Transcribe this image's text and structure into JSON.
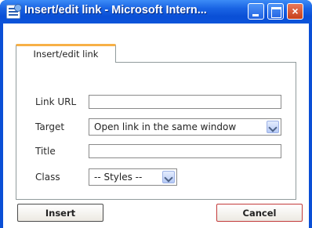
{
  "window": {
    "title": "Insert/edit link - Microsoft Intern...",
    "close_glyph": "×"
  },
  "tab": {
    "label": "Insert/edit link"
  },
  "form": {
    "link_url": {
      "label": "Link URL",
      "value": ""
    },
    "target": {
      "label": "Target",
      "selected": "Open link in the same window"
    },
    "title": {
      "label": "Title",
      "value": ""
    },
    "class": {
      "label": "Class",
      "selected": "-- Styles --"
    }
  },
  "buttons": {
    "insert": "Insert",
    "cancel": "Cancel"
  },
  "colors": {
    "titlebar": "#0a4fd6",
    "close_button": "#c7401a",
    "tab_accent": "#f7b046"
  },
  "icons": {
    "app": "document-window-icon",
    "minimize": "minimize-icon",
    "maximize": "maximize-icon",
    "close": "close-icon",
    "dropdown": "chevron-down-icon"
  }
}
